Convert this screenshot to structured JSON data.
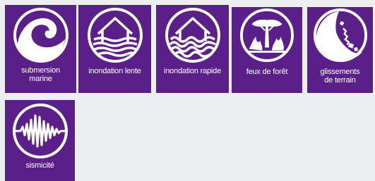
{
  "tiles": [
    {
      "id": "submersion",
      "label": "submersion\nmarine",
      "icon": "wave-icon"
    },
    {
      "id": "inondation-lente",
      "label": "inondation lente",
      "icon": "flooded-house-icon"
    },
    {
      "id": "inondation-rapide",
      "label": "inondation rapide",
      "icon": "flooded-house-icon"
    },
    {
      "id": "feux",
      "label": "feux de forêt",
      "icon": "forest-fire-icon"
    },
    {
      "id": "glissements",
      "label": "glissements\nde terrain",
      "icon": "landslide-icon"
    },
    {
      "id": "sismicite",
      "label": "sismicité",
      "icon": "seismograph-icon"
    }
  ],
  "colors": {
    "tile_background": "#5a1f88",
    "page_background": "#eceef0",
    "foreground": "#ffffff"
  }
}
